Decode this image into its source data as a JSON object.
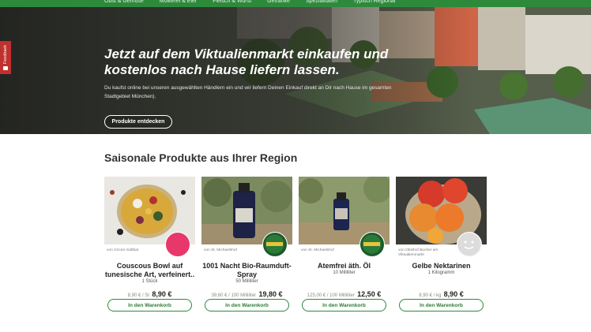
{
  "nav": {
    "items": [
      "Obst & Gemüse",
      "Molkerei & Eier",
      "Fleisch & Wurst",
      "Getränke",
      "Spezialitäten",
      "Typisch Regional"
    ]
  },
  "feedback": {
    "label": "Feedback"
  },
  "hero": {
    "title": "Jetzt auf dem Viktualienmarkt einkaufen und kostenlos nach Hause liefern lassen.",
    "text": "Du kaufst online bei unseren ausgewählten Händlern ein und wir liefern Deinen Einkauf direkt an Dir nach Hause im gesamten Stadtgebiet München).",
    "cta": "Produkte entdecken"
  },
  "section": {
    "title": "Saisonale Produkte aus Ihrer Region"
  },
  "products": [
    {
      "vendor": "von Cricice Saftbar",
      "name": "Couscous Bowl auf tunesische Art, verfeinert..",
      "qty": "1 Stück",
      "unit_price": "8,90 € / St",
      "price": "8,90 €",
      "button": "In den Warenkorb"
    },
    {
      "vendor": "von St. Michaelshof",
      "name": "1001 Nacht Bio-Raumduft-Spray",
      "qty": "50 Milliliter",
      "unit_price": "39,60 € / 100 Milliliter",
      "price": "19,80 €",
      "button": "In den Warenkorb"
    },
    {
      "vendor": "von St. Michaelshof",
      "name": "Atemfrei äth. Öl",
      "qty": "10 Milliliter",
      "unit_price": "125,00 € / 100 Milliliter",
      "price": "12,50 €",
      "button": "In den Warenkorb"
    },
    {
      "vendor": "von Obsthof Bucher am Viktualienmarkt",
      "name": "Gelbe Nektarinen",
      "qty": "1 Kilogramm",
      "unit_price": "8,90 € / kg",
      "price": "8,90 €",
      "button": "In den Warenkorb"
    }
  ],
  "colors": {
    "brand_green": "#2d8a3b",
    "feedback_red": "#c0302e"
  }
}
